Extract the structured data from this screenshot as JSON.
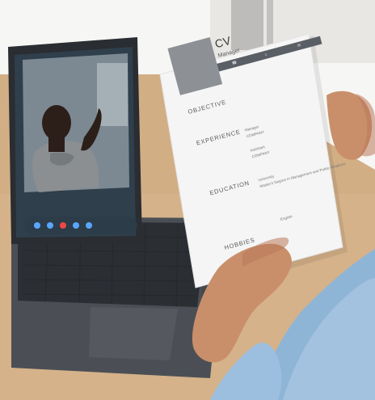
{
  "scene": {
    "colors": {
      "table": "#d5b28a",
      "wall": "#f6f6f4",
      "laptop": "#4b4f55",
      "screen_bg": "#2f3f4c",
      "paper": "#f5f5f5",
      "shirt": "#8fb5d6",
      "skin": "#c98f6a"
    }
  },
  "video_call": {
    "controls": [
      {
        "name": "mic",
        "icon": "mic-icon"
      },
      {
        "name": "video",
        "icon": "video-icon"
      },
      {
        "name": "end",
        "icon": "end-call-icon"
      },
      {
        "name": "chat",
        "icon": "chat-icon"
      },
      {
        "name": "more",
        "icon": "more-icon"
      }
    ]
  },
  "cv": {
    "title": "CV",
    "role": "Manager",
    "sections": {
      "objective": "OBJECTIVE",
      "experience": "EXPERIENCE",
      "education": "EDUCATION",
      "hobbies": "HOBBIES"
    },
    "experience": [
      {
        "role": "Manager",
        "company": "COMPANY"
      },
      {
        "role": "Assistant",
        "company": "COMPANY"
      }
    ],
    "education": {
      "school": "University",
      "degree": "Master's Degree in Management and Public Relations"
    },
    "skills": [
      "English"
    ]
  }
}
